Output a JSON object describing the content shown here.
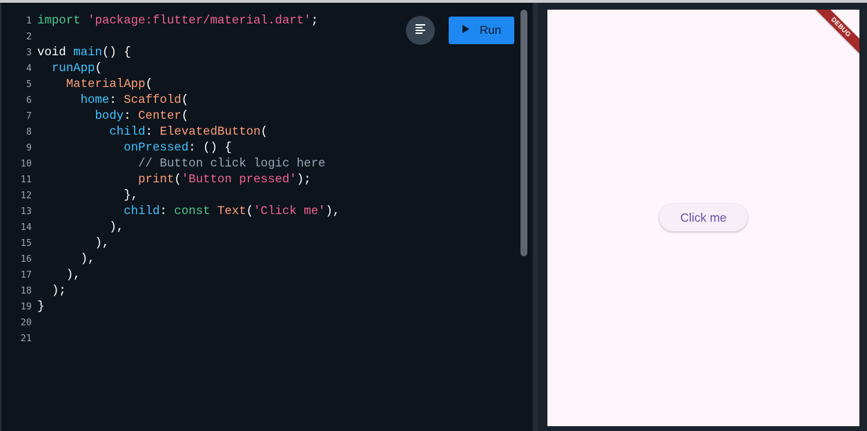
{
  "editor": {
    "line_numbers": [
      "1",
      "2",
      "3",
      "4",
      "5",
      "6",
      "7",
      "8",
      "9",
      "10",
      "11",
      "12",
      "13",
      "14",
      "15",
      "16",
      "17",
      "18",
      "19",
      "20",
      "21"
    ],
    "lines": [
      [
        {
          "t": "import ",
          "c": "k"
        },
        {
          "t": "'package:flutter/material.dart'",
          "c": "s"
        },
        {
          "t": ";",
          "c": "w"
        }
      ],
      [],
      [
        {
          "t": "void ",
          "c": "w"
        },
        {
          "t": "main",
          "c": "f"
        },
        {
          "t": "() {",
          "c": "w"
        }
      ],
      [
        {
          "t": "  ",
          "c": "w"
        },
        {
          "t": "runApp",
          "c": "f"
        },
        {
          "t": "(",
          "c": "w"
        }
      ],
      [
        {
          "t": "    ",
          "c": "w"
        },
        {
          "t": "MaterialApp",
          "c": "c"
        },
        {
          "t": "(",
          "c": "w"
        }
      ],
      [
        {
          "t": "      ",
          "c": "w"
        },
        {
          "t": "home",
          "c": "f"
        },
        {
          "t": ": ",
          "c": "w"
        },
        {
          "t": "Scaffold",
          "c": "c"
        },
        {
          "t": "(",
          "c": "w"
        }
      ],
      [
        {
          "t": "        ",
          "c": "w"
        },
        {
          "t": "body",
          "c": "f"
        },
        {
          "t": ": ",
          "c": "w"
        },
        {
          "t": "Center",
          "c": "c"
        },
        {
          "t": "(",
          "c": "w"
        }
      ],
      [
        {
          "t": "          ",
          "c": "w"
        },
        {
          "t": "child",
          "c": "f"
        },
        {
          "t": ": ",
          "c": "w"
        },
        {
          "t": "ElevatedButton",
          "c": "c"
        },
        {
          "t": "(",
          "c": "w"
        }
      ],
      [
        {
          "t": "            ",
          "c": "w"
        },
        {
          "t": "onPressed",
          "c": "f"
        },
        {
          "t": ": () {",
          "c": "w"
        }
      ],
      [
        {
          "t": "              ",
          "c": "w"
        },
        {
          "t": "// Button click logic here",
          "c": "cm"
        }
      ],
      [
        {
          "t": "              ",
          "c": "w"
        },
        {
          "t": "print",
          "c": "c"
        },
        {
          "t": "(",
          "c": "w"
        },
        {
          "t": "'Button pressed'",
          "c": "s"
        },
        {
          "t": ");",
          "c": "w"
        }
      ],
      [
        {
          "t": "            },",
          "c": "w"
        }
      ],
      [
        {
          "t": "            ",
          "c": "w"
        },
        {
          "t": "child",
          "c": "f"
        },
        {
          "t": ": ",
          "c": "w"
        },
        {
          "t": "const ",
          "c": "k"
        },
        {
          "t": "Text",
          "c": "c"
        },
        {
          "t": "(",
          "c": "w"
        },
        {
          "t": "'Click me'",
          "c": "s"
        },
        {
          "t": "),",
          "c": "w"
        }
      ],
      [
        {
          "t": "          ),",
          "c": "w"
        }
      ],
      [
        {
          "t": "        ),",
          "c": "w"
        }
      ],
      [
        {
          "t": "      ),",
          "c": "w"
        }
      ],
      [
        {
          "t": "    ),",
          "c": "w"
        }
      ],
      [
        {
          "t": "  );",
          "c": "w"
        }
      ],
      [
        {
          "t": "}",
          "c": "w"
        }
      ],
      [],
      []
    ]
  },
  "toolbar": {
    "format_icon": "format-align-left-icon",
    "run_icon": "play-icon",
    "run_label": "Run"
  },
  "preview": {
    "debug_banner": "DEBUG",
    "button_label": "Click me"
  },
  "colors": {
    "run_button": "#1e88f2",
    "editor_background": "#0d141c",
    "app_background": "#fdf7fd",
    "button_text": "#6750a4",
    "debug_banner": "#a52a2a"
  }
}
